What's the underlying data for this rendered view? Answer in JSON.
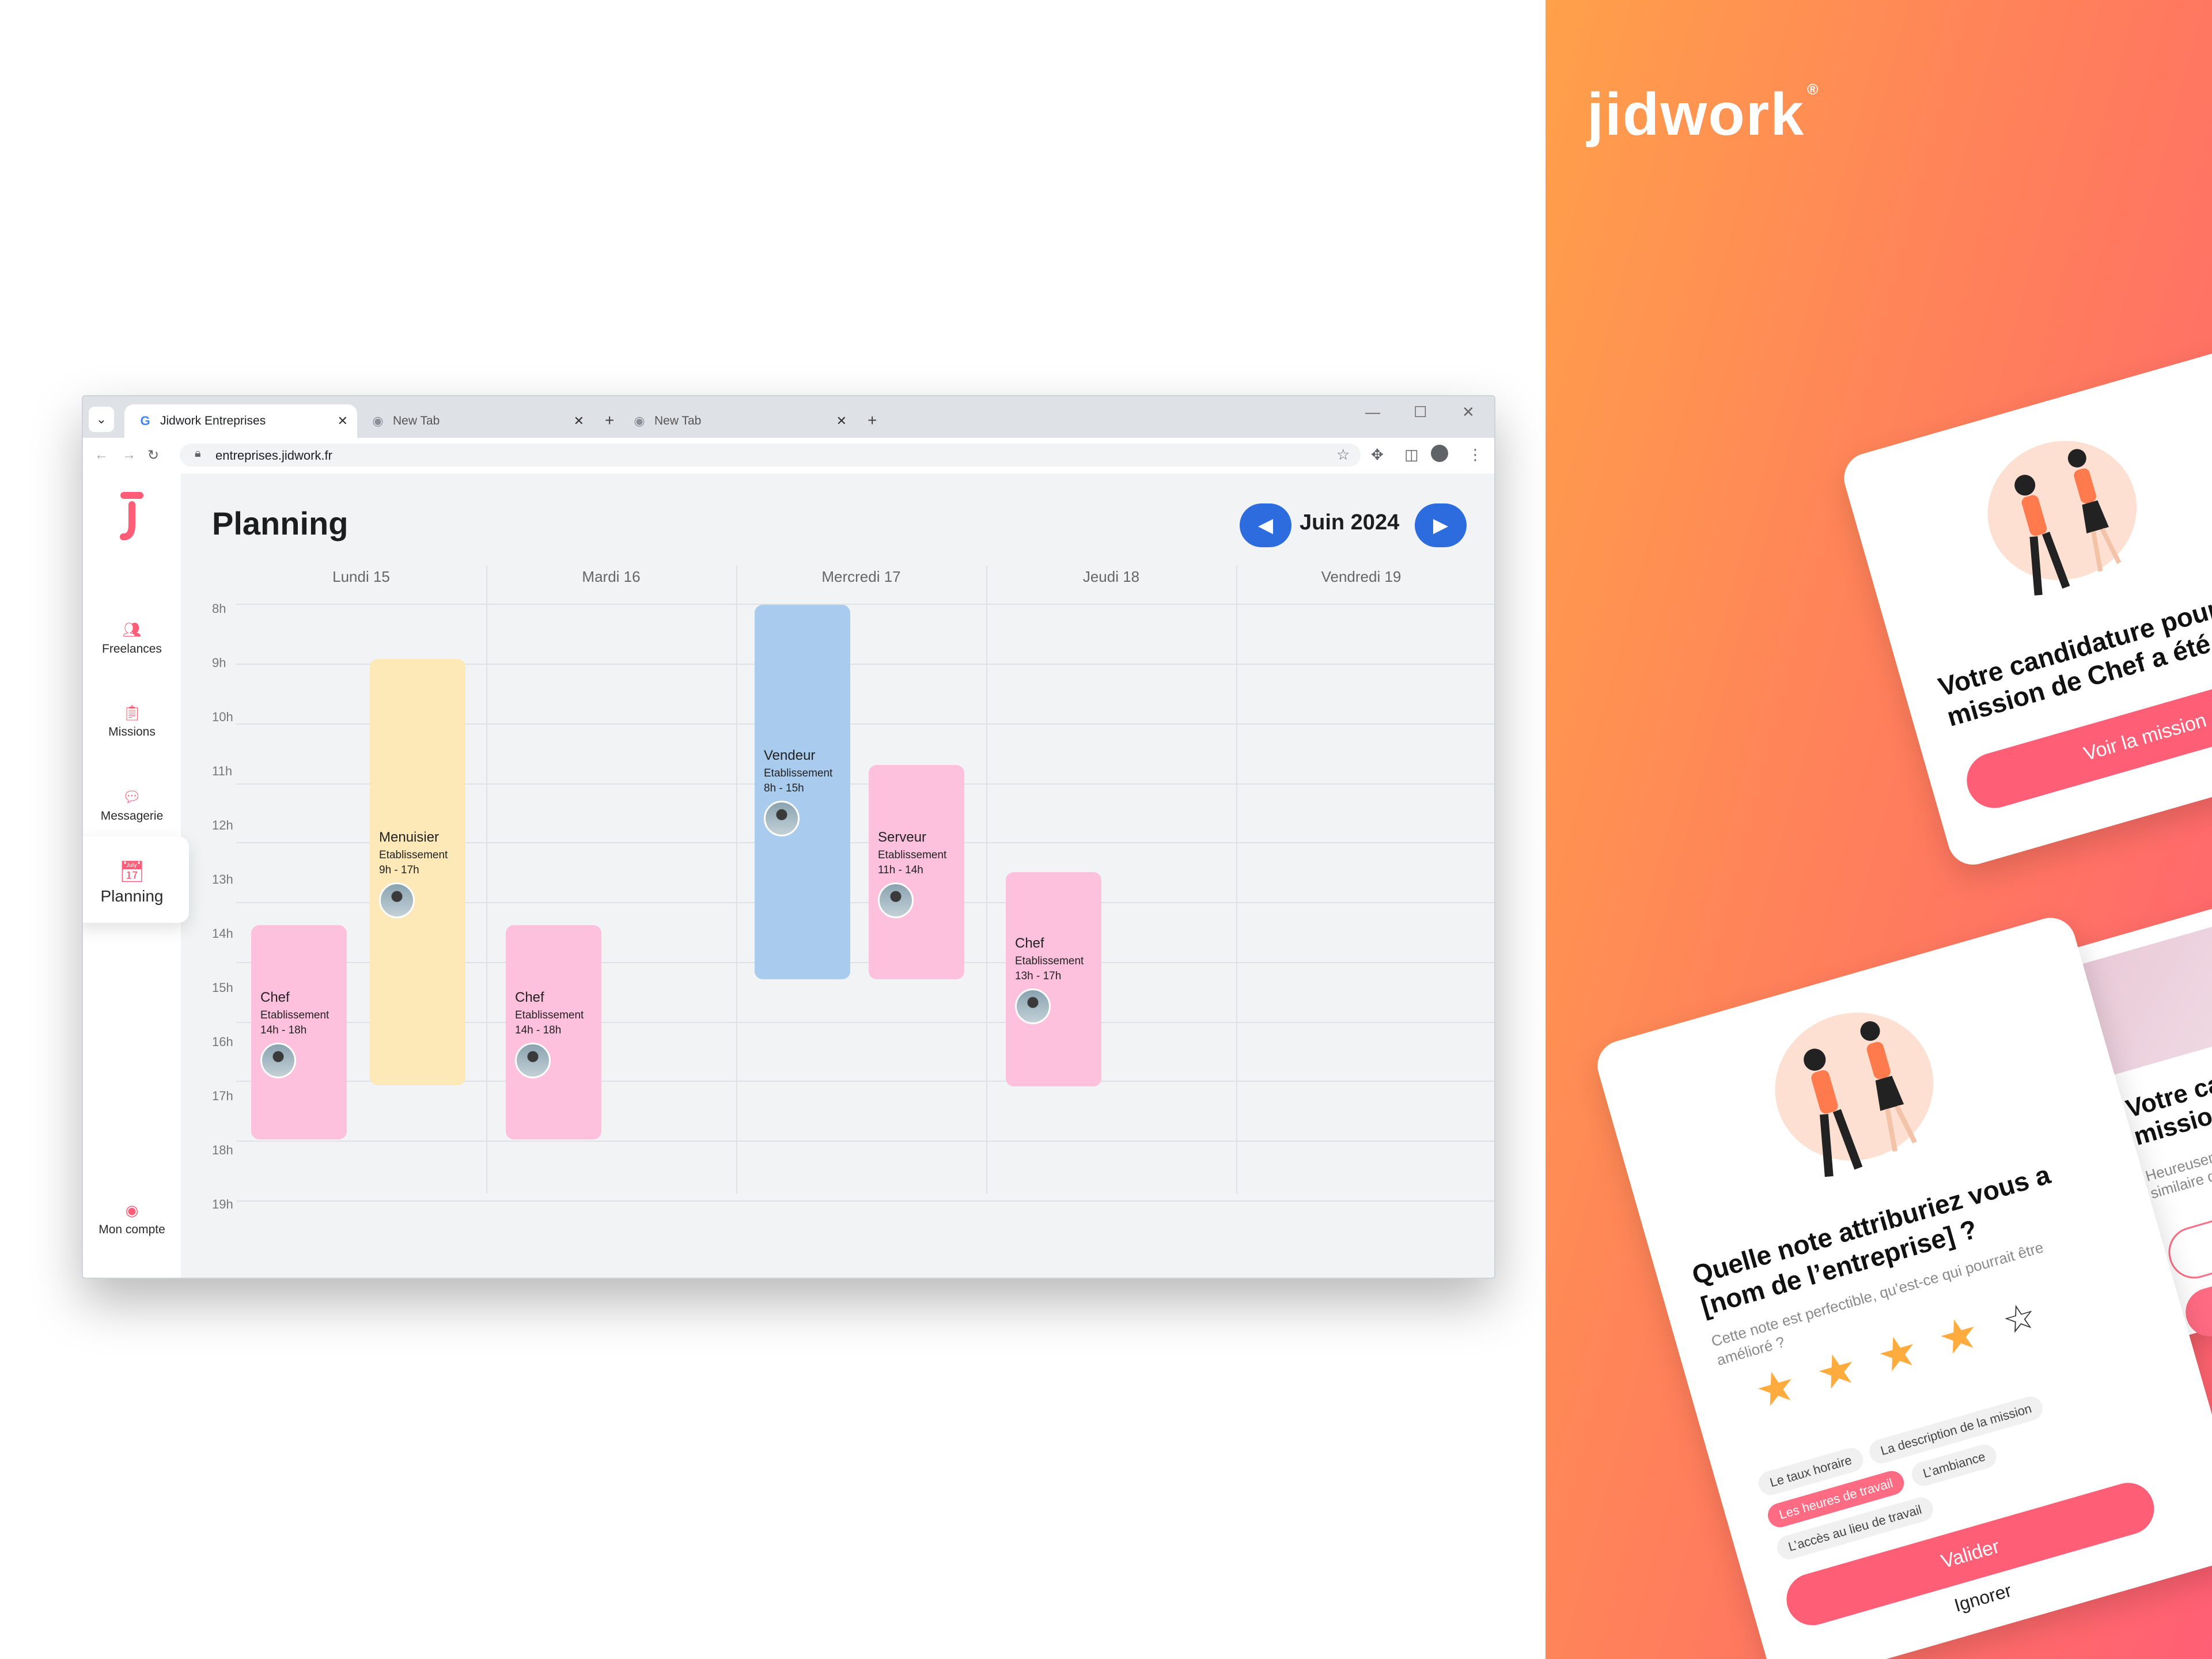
{
  "browser": {
    "tabs": [
      {
        "title": "Jidwork Entreprises",
        "icon": "google-g-icon",
        "active": true
      },
      {
        "title": "New Tab",
        "icon": "chrome-icon",
        "active": false
      },
      {
        "title": "New Tab",
        "icon": "chrome-icon",
        "active": false
      }
    ],
    "url": "entreprises.jidwork.fr"
  },
  "sidebar": {
    "items": [
      {
        "label": "Freelances",
        "icon": "users-list-icon"
      },
      {
        "label": "Missions",
        "icon": "missions-icon"
      },
      {
        "label": "Messagerie",
        "icon": "chat-icon"
      },
      {
        "label": "Planning",
        "icon": "calendar-check-icon",
        "active": true
      }
    ],
    "account_label": "Mon compte",
    "accent": "#ff5c77"
  },
  "planning": {
    "title": "Planning",
    "month": "Juin 2024",
    "days": [
      "Lundi 15",
      "Mardi 16",
      "Mercredi 17",
      "Jeudi 18",
      "Vendredi 19"
    ],
    "hours": [
      "8h",
      "9h",
      "10h",
      "11h",
      "12h",
      "13h",
      "14h",
      "15h",
      "16h",
      "17h",
      "18h",
      "19h"
    ],
    "events": [
      {
        "title": "Chef",
        "place": "Etablissement",
        "time": "14h - 18h",
        "color": "#fdc0dd"
      },
      {
        "title": "Menuisier",
        "place": "Etablissement",
        "time": "9h - 17h",
        "color": "#fde8b8"
      },
      {
        "title": "Chef",
        "place": "Etablissement",
        "time": "14h - 18h",
        "color": "#fdc0dd"
      },
      {
        "title": "Vendeur",
        "place": "Etablissement",
        "time": "8h - 15h",
        "color": "#a9cbed"
      },
      {
        "title": "Serveur",
        "place": "Etablissement",
        "time": "11h - 14h",
        "color": "#fdc0dd"
      },
      {
        "title": "Chef",
        "place": "Etablissement",
        "time": "13h - 17h",
        "color": "#fdc0dd"
      }
    ],
    "nav_color": "#2d6cdf"
  },
  "promo": {
    "brand": "jidwork",
    "card1": {
      "heading_l1": "Votre candidature pour",
      "heading_l2": "mission de Chef a été acce",
      "button": "Voir la mission"
    },
    "card2": {
      "heading_l1": "Quelle note attriburiez vous a",
      "heading_l2": "[nom de l’entreprise] ?",
      "body_l1": "Cette note est perfectible, qu’est-ce qui pourrait être",
      "body_l2": "amélioré ?",
      "rating": 4,
      "rating_max": 5,
      "chips": [
        "Le taux horaire",
        "La description de la mission",
        "Les heures de travail",
        "L’ambiance",
        "L’accès au lieu de travail"
      ],
      "selected_chip": "Les heures de travail",
      "button": "Valider",
      "secondary": "Ignorer"
    },
    "card3": {
      "heading_l1": "Votre cand",
      "heading_l2": "mission d",
      "body_l1": "Heureusemen",
      "body_l2": "similaire qui"
    }
  }
}
